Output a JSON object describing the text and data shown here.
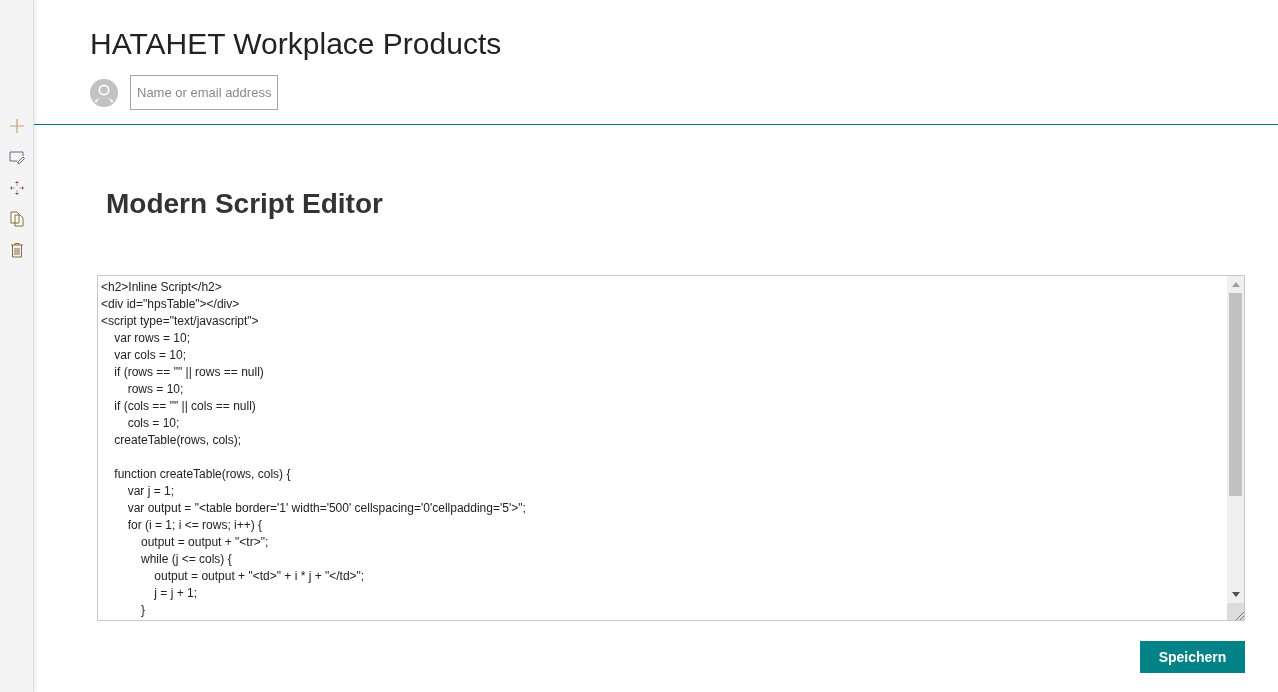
{
  "site": {
    "title": "HATAHET Workplace Products",
    "people_picker": {
      "placeholder": "Name or email address"
    }
  },
  "webpart": {
    "title": "Modern Script Editor",
    "code": "<h2>Inline Script</h2>\n<div id=\"hpsTable\"></div>\n<script type=\"text/javascript\">\n    var rows = 10;\n    var cols = 10;\n    if (rows == \"\" || rows == null)\n        rows = 10;\n    if (cols == \"\" || cols == null)\n        cols = 10;\n    createTable(rows, cols);\n\n    function createTable(rows, cols) {\n        var j = 1;\n        var output = \"<table border='1' width='500' cellspacing='0'cellpadding='5'>\";\n        for (i = 1; i <= rows; i++) {\n            output = output + \"<tr>\";\n            while (j <= cols) {\n                output = output + \"<td>\" + i * j + \"</td>\";\n                j = j + 1;\n            }",
    "save_button": "Speichern"
  }
}
